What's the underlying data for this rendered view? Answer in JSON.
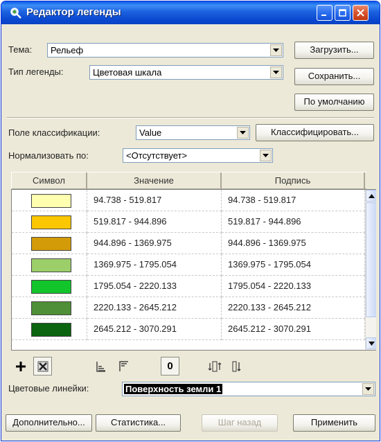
{
  "window": {
    "title": "Редактор легенды"
  },
  "form": {
    "theme_label": "Тема:",
    "theme_value": "Рельеф",
    "legend_type_label": "Тип легенды:",
    "legend_type_value": "Цветовая шкала",
    "class_field_label": "Поле классификации:",
    "class_field_value": "Value",
    "normalize_label": "Нормализовать по:",
    "normalize_value": "<Отсутствует>",
    "color_ramp_label": "Цветовые линейки:",
    "color_ramp_value": "Поверхность земли 1"
  },
  "buttons": {
    "load": "Загрузить...",
    "save": "Сохранить...",
    "default": "По умолчанию",
    "classify": "Классифицировать...",
    "advanced": "Дополнительно...",
    "statistics": "Статистика...",
    "undo": "Шаг назад",
    "apply": "Применить"
  },
  "table": {
    "columns": [
      "Символ",
      "Значение",
      "Подпись"
    ],
    "rows": [
      {
        "color": "#ffffb0",
        "value": "94.738 - 519.817",
        "label": "94.738 - 519.817"
      },
      {
        "color": "#fbc700",
        "value": "519.817 - 944.896",
        "label": "519.817 - 944.896"
      },
      {
        "color": "#d49b09",
        "value": "944.896 - 1369.975",
        "label": "944.896 - 1369.975"
      },
      {
        "color": "#9ccf6a",
        "value": "1369.975 - 1795.054",
        "label": "1369.975 - 1795.054"
      },
      {
        "color": "#11c52a",
        "value": "1795.054 - 2220.133",
        "label": "1795.054 - 2220.133"
      },
      {
        "color": "#4f8f37",
        "value": "2220.133 - 2645.212",
        "label": "2220.133 - 2645.212"
      },
      {
        "color": "#0a6410",
        "value": "2645.212 - 3070.291",
        "label": "2645.212 - 3070.291"
      }
    ]
  },
  "toolbar": {
    "add_icon": "plus-icon",
    "delete_icon": "delete-icon",
    "sort_asc_icon": "sort-ascending-icon",
    "sort_desc_icon": "sort-descending-icon",
    "zero_label": "0",
    "reverse_icon": "reverse-order-icon",
    "flip_icon": "flip-icon"
  }
}
